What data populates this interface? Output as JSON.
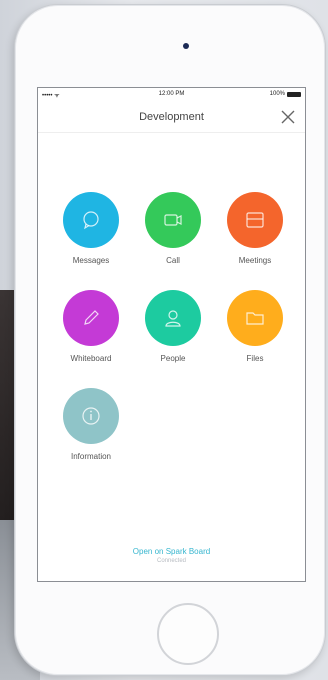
{
  "status_bar": {
    "signal": "••••• ᯤ",
    "time": "12:00 PM",
    "battery": "100%"
  },
  "header": {
    "title": "Development"
  },
  "apps": [
    {
      "label": "Messages",
      "color": "#1fb5e3",
      "icon": "message-icon"
    },
    {
      "label": "Call",
      "color": "#34c95a",
      "icon": "video-icon"
    },
    {
      "label": "Meetings",
      "color": "#f4652c",
      "icon": "calendar-icon"
    },
    {
      "label": "Whiteboard",
      "color": "#c43ad6",
      "icon": "pencil-icon"
    },
    {
      "label": "People",
      "color": "#1dcba0",
      "icon": "person-icon"
    },
    {
      "label": "Files",
      "color": "#ffad1c",
      "icon": "folder-icon"
    },
    {
      "label": "Information",
      "color": "#8fc4c8",
      "icon": "info-icon"
    }
  ],
  "footer": {
    "link": "Open on Spark Board",
    "subtitle": "Connected"
  }
}
